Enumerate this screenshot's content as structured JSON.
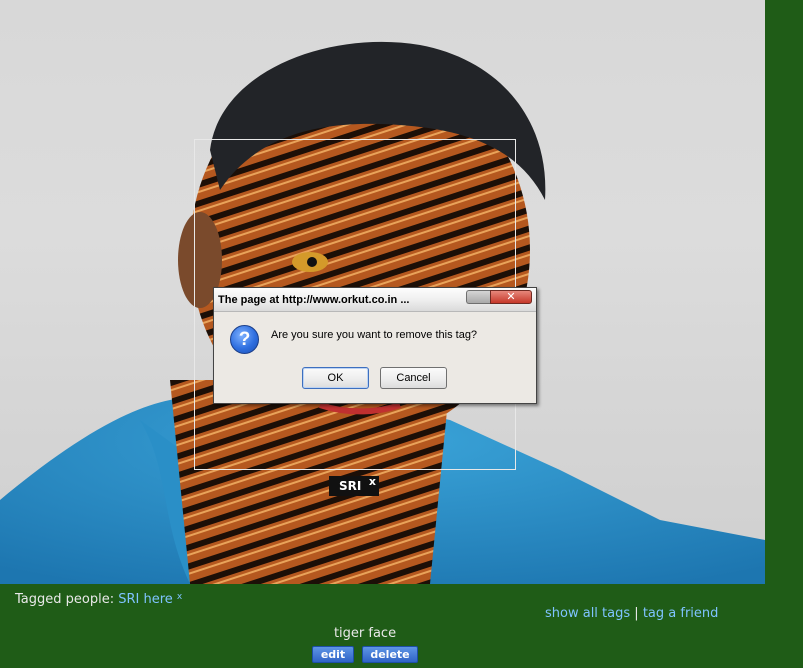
{
  "dialog": {
    "title": "The page at http://www.orkut.co.in ...",
    "message": "Are you sure you want to remove this tag?",
    "ok_label": "OK",
    "cancel_label": "Cancel",
    "icon": "question-icon"
  },
  "photo": {
    "tag_name": "SRI",
    "tag_remove": "x"
  },
  "footer": {
    "tagged_label": "Tagged people:",
    "tagged_person": "SRI here",
    "tagged_remove": "x",
    "show_all_tags": "show all tags",
    "separator": "|",
    "tag_friend": "tag a friend",
    "caption": "tiger face",
    "edit_label": "edit",
    "delete_label": "delete"
  },
  "colors": {
    "page_bg": "#1f5c17",
    "link": "#7fc3ff",
    "button": "#2f63c6"
  }
}
